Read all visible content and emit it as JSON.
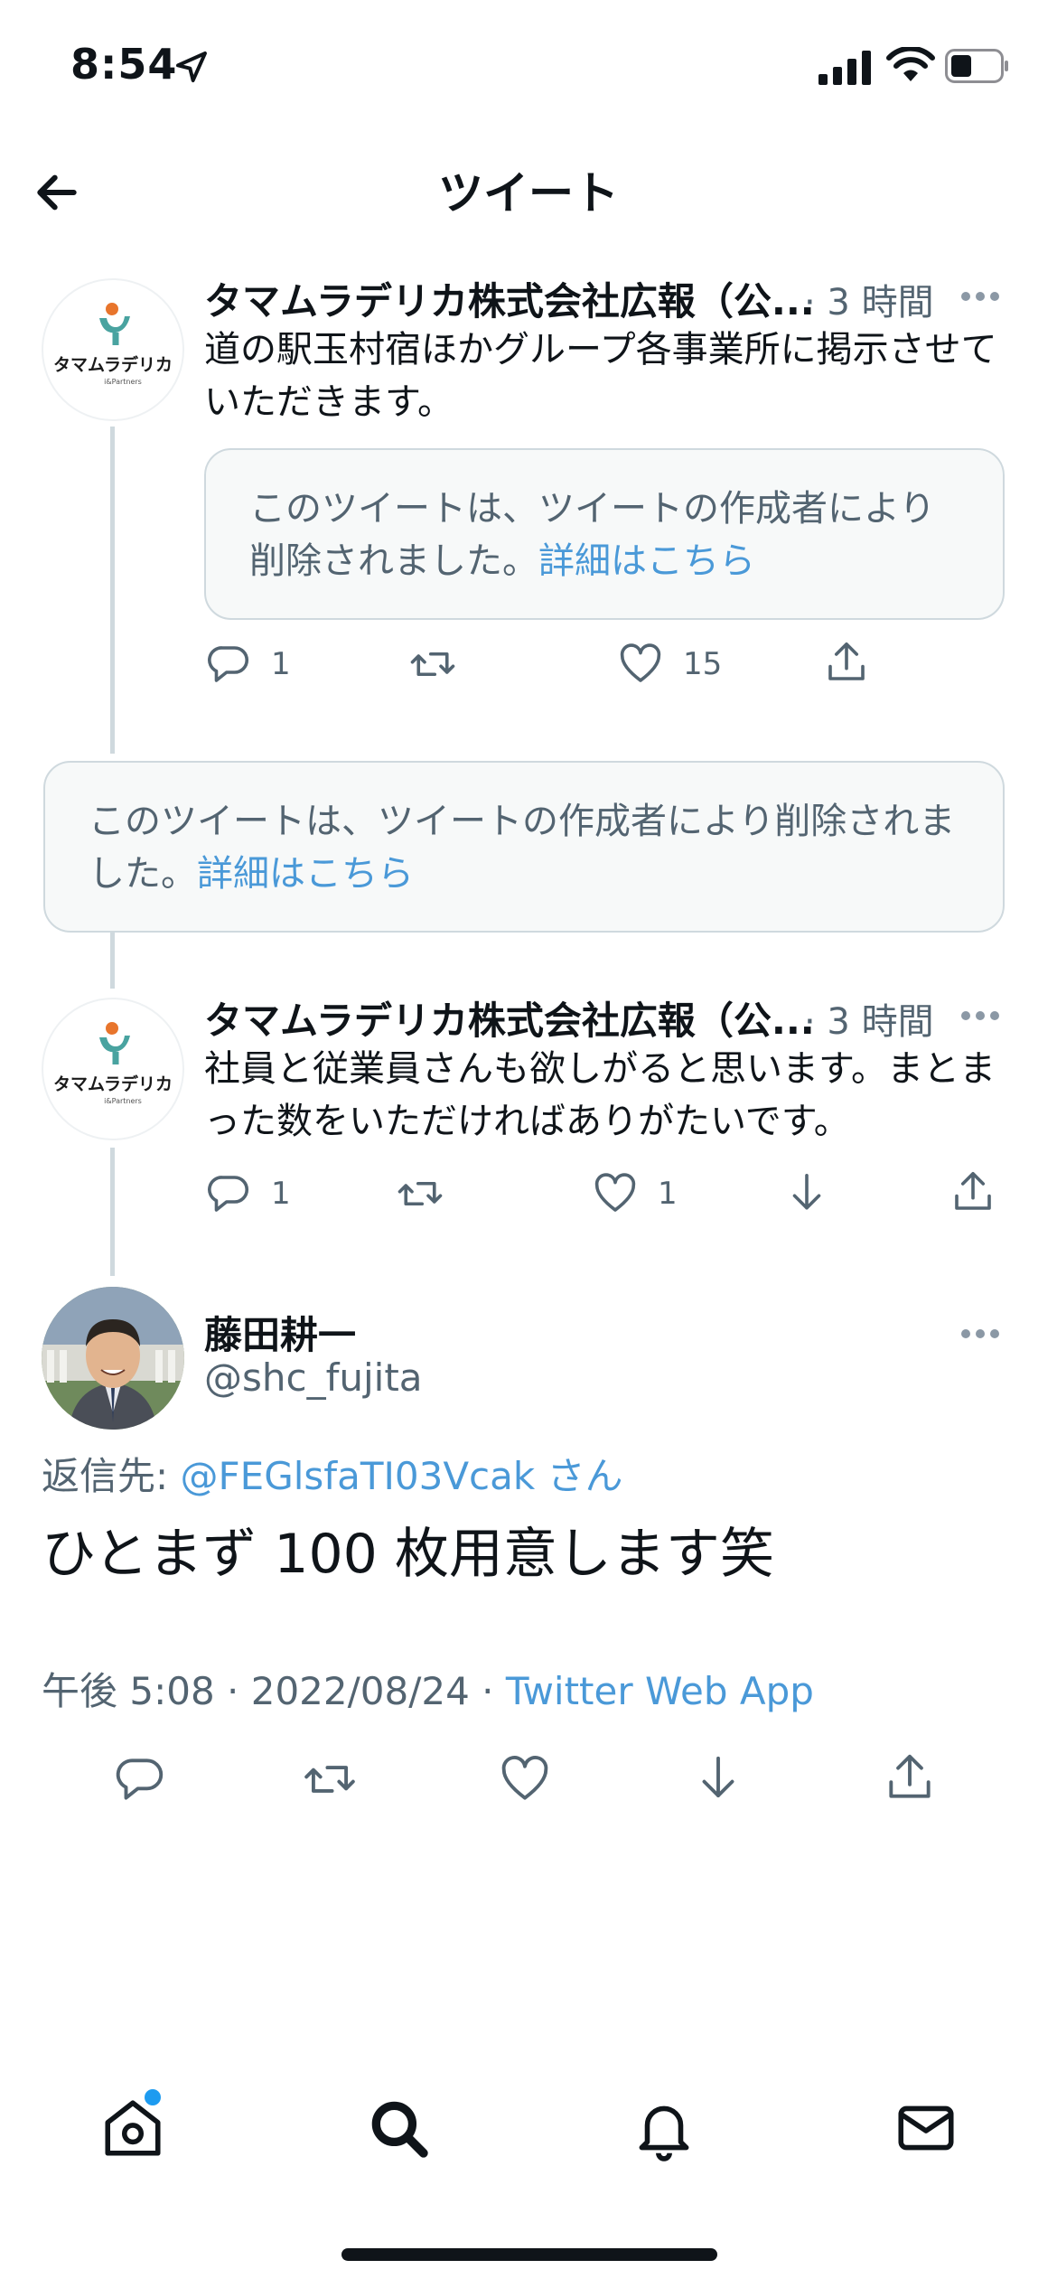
{
  "status_bar": {
    "time": "8:54"
  },
  "header": {
    "title": "ツイート"
  },
  "tweet1": {
    "name": "タマムラデリカ株式会社広報（公...",
    "time": "· 3 時間",
    "text": "道の駅玉村宿ほかグループ各事業所に掲示させていただきます。",
    "quote_deleted_text": "このツイートは、ツイートの作成者により削除されました。",
    "quote_link": "詳細はこちら",
    "reply_count": "1",
    "like_count": "15"
  },
  "deleted_tweet": {
    "text": "このツイートは、ツイートの作成者により削除されました。",
    "link": "詳細はこちら"
  },
  "tweet2": {
    "name": "タマムラデリカ株式会社広報（公...",
    "time": "· 3 時間",
    "text": "社員と従業員さんも欲しがると思います。まとまった数をいただければありがたいです。",
    "reply_count": "1",
    "like_count": "1"
  },
  "main_tweet": {
    "name": "藤田耕一",
    "handle": "@shc_fujita",
    "reply_to_label": "返信先:",
    "reply_to_user": "@FEGlsfaTI03Vcak さん",
    "text": "ひとまず 100 枚用意します笑",
    "timestamp": "午後 5:08 · 2022/08/24 ·",
    "source": "Twitter Web App"
  },
  "logo": {
    "brand_text": "タマムラデリカ",
    "sub_text": "i&Partners"
  },
  "colors": {
    "link": "#4a99d8",
    "muted": "#536471",
    "notification_dot": "#1d9bf0"
  },
  "tab_bar": {
    "icons": [
      "home-icon",
      "search-icon",
      "notifications-icon",
      "messages-icon"
    ]
  }
}
